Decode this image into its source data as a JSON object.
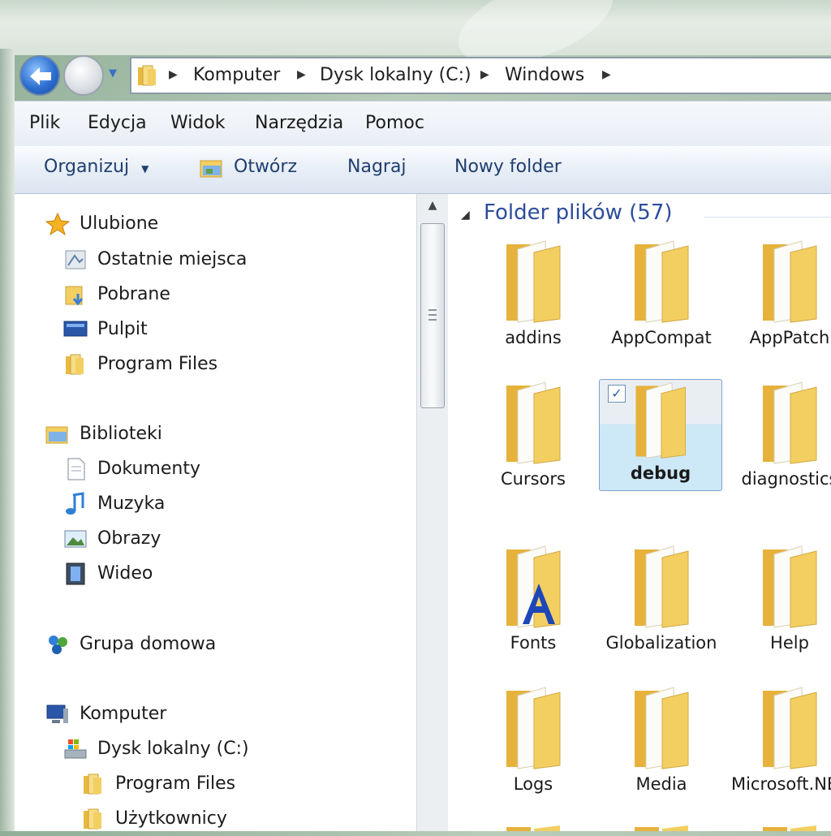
{
  "address": {
    "crumbs": [
      "Komputer",
      "Dysk lokalny (C:)",
      "Windows"
    ]
  },
  "menu": [
    "Plik",
    "Edycja",
    "Widok",
    "Narzędzia",
    "Pomoc"
  ],
  "toolbar": {
    "organize": "Organizuj",
    "open": "Otwórz",
    "burn": "Nagraj",
    "new_folder": "Nowy folder"
  },
  "nav": {
    "favorites": "Ulubione",
    "recent": "Ostatnie miejsca",
    "downloads": "Pobrane",
    "desktop": "Pulpit",
    "program_files_fav": "Program Files",
    "libraries": "Biblioteki",
    "documents": "Dokumenty",
    "music": "Muzyka",
    "pictures": "Obrazy",
    "video": "Wideo",
    "homegroup": "Grupa domowa",
    "computer": "Komputer",
    "local_disk": "Dysk lokalny (C:)",
    "program_files": "Program Files",
    "users": "Użytkownicy"
  },
  "content": {
    "group_title": "Folder plików (57)",
    "folders": [
      "addins",
      "AppCompat",
      "AppPatch",
      "Cursors",
      "debug",
      "diagnostics",
      "Fonts",
      "Globalization",
      "Help",
      "Logs",
      "Media",
      "Microsoft.NET"
    ]
  },
  "colors": {
    "accent_blue": "#2d4d9b",
    "selection": "#cde8f7",
    "folder_yellow": "#f3cf62"
  }
}
